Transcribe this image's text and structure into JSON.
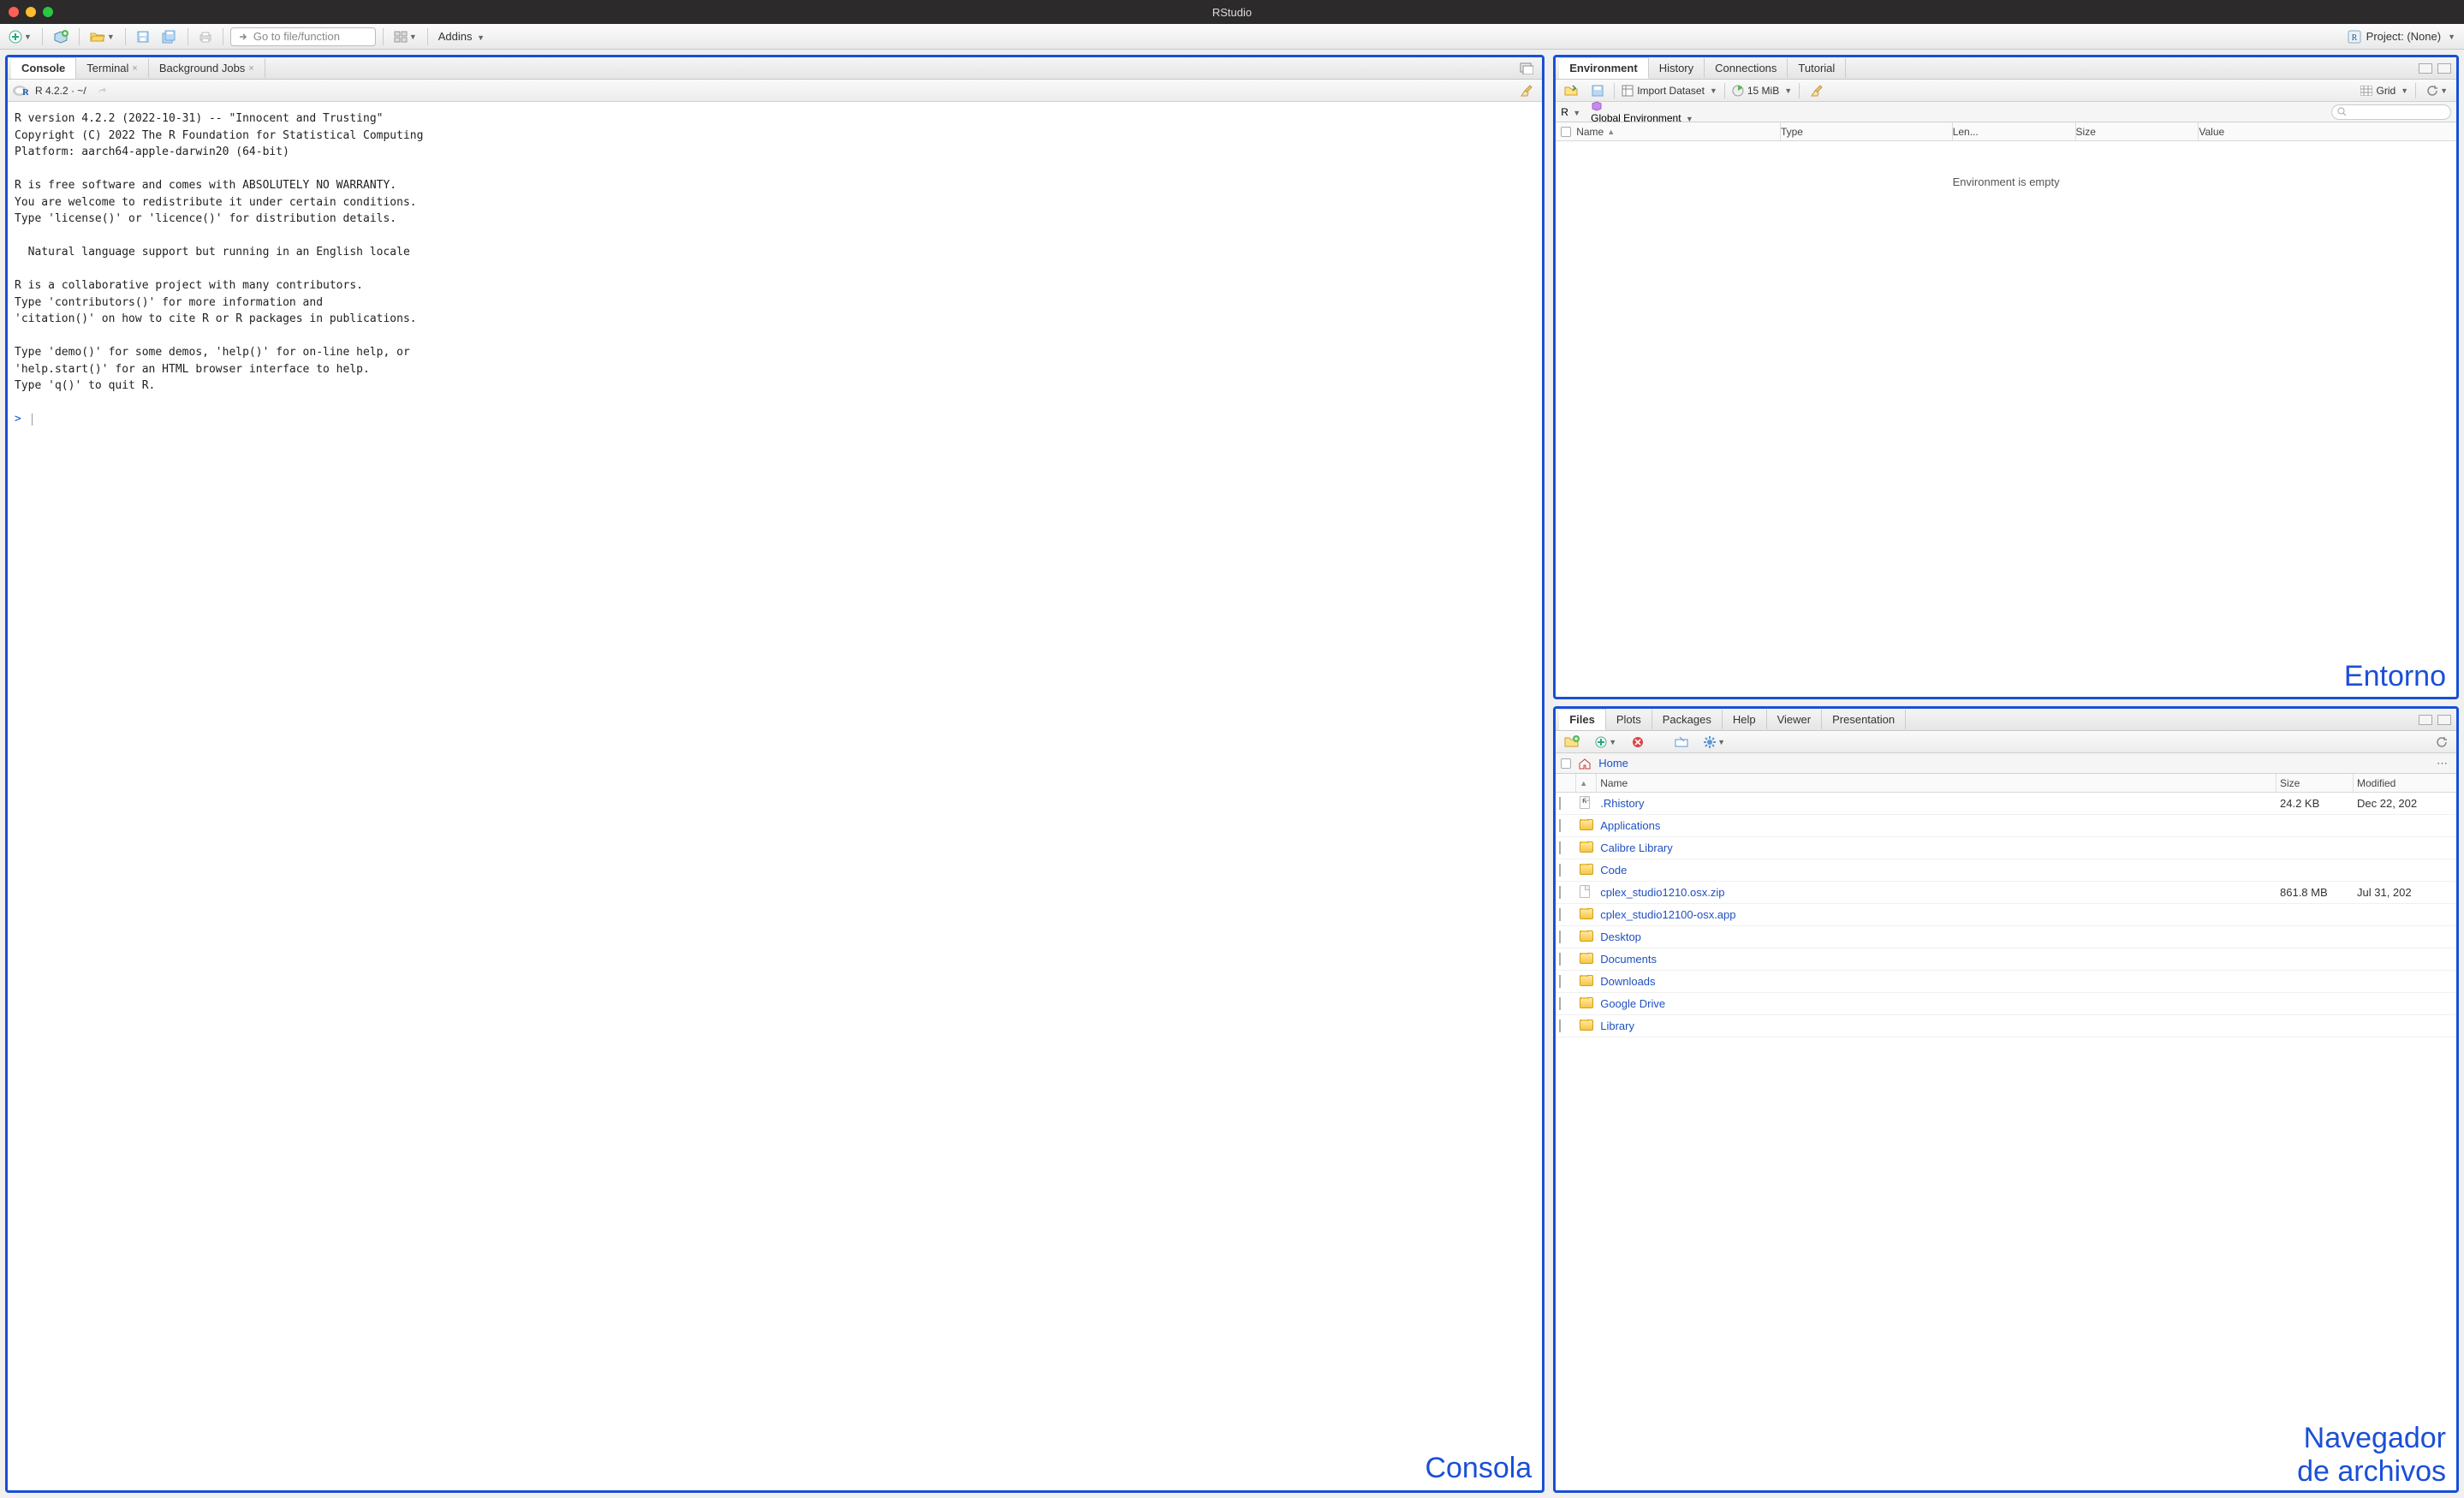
{
  "window": {
    "title": "RStudio"
  },
  "toolbar": {
    "goto_placeholder": "Go to file/function",
    "addins_label": "Addins",
    "project_label": "Project: (None)"
  },
  "left_pane": {
    "tabs": [
      "Console",
      "Terminal",
      "Background Jobs"
    ],
    "active_tab": 0,
    "subtitle": "R 4.2.2 · ~/",
    "console_text": "R version 4.2.2 (2022-10-31) -- \"Innocent and Trusting\"\nCopyright (C) 2022 The R Foundation for Statistical Computing\nPlatform: aarch64-apple-darwin20 (64-bit)\n\nR is free software and comes with ABSOLUTELY NO WARRANTY.\nYou are welcome to redistribute it under certain conditions.\nType 'license()' or 'licence()' for distribution details.\n\n  Natural language support but running in an English locale\n\nR is a collaborative project with many contributors.\nType 'contributors()' for more information and\n'citation()' on how to cite R or R packages in publications.\n\nType 'demo()' for some demos, 'help()' for on-line help, or\n'help.start()' for an HTML browser interface to help.\nType 'q()' to quit R.\n",
    "prompt": ">",
    "label": "Consola"
  },
  "env_pane": {
    "tabs": [
      "Environment",
      "History",
      "Connections",
      "Tutorial"
    ],
    "active_tab": 0,
    "import_label": "Import Dataset",
    "mem_label": "15 MiB",
    "view_label": "Grid",
    "scope_left": "R",
    "scope_right": "Global Environment",
    "headers": [
      "Name",
      "Type",
      "Len...",
      "Size",
      "Value"
    ],
    "empty_text": "Environment is empty",
    "label": "Entorno"
  },
  "files_pane": {
    "tabs": [
      "Files",
      "Plots",
      "Packages",
      "Help",
      "Viewer",
      "Presentation"
    ],
    "active_tab": 0,
    "breadcrumb_home": "Home",
    "headers": {
      "name": "Name",
      "size": "Size",
      "modified": "Modified"
    },
    "rows": [
      {
        "icon": "r-file",
        "name": ".Rhistory",
        "size": "24.2 KB",
        "modified": "Dec 22, 202"
      },
      {
        "icon": "folder",
        "name": "Applications",
        "size": "",
        "modified": ""
      },
      {
        "icon": "folder",
        "name": "Calibre Library",
        "size": "",
        "modified": ""
      },
      {
        "icon": "folder",
        "name": "Code",
        "size": "",
        "modified": ""
      },
      {
        "icon": "file",
        "name": "cplex_studio1210.osx.zip",
        "size": "861.8 MB",
        "modified": "Jul 31, 202"
      },
      {
        "icon": "folder",
        "name": "cplex_studio12100-osx.app",
        "size": "",
        "modified": ""
      },
      {
        "icon": "folder",
        "name": "Desktop",
        "size": "",
        "modified": ""
      },
      {
        "icon": "folder",
        "name": "Documents",
        "size": "",
        "modified": ""
      },
      {
        "icon": "folder",
        "name": "Downloads",
        "size": "",
        "modified": ""
      },
      {
        "icon": "folder",
        "name": "Google Drive",
        "size": "",
        "modified": ""
      },
      {
        "icon": "folder",
        "name": "Library",
        "size": "",
        "modified": ""
      }
    ],
    "label_line1": "Navegador",
    "label_line2": "de archivos"
  }
}
